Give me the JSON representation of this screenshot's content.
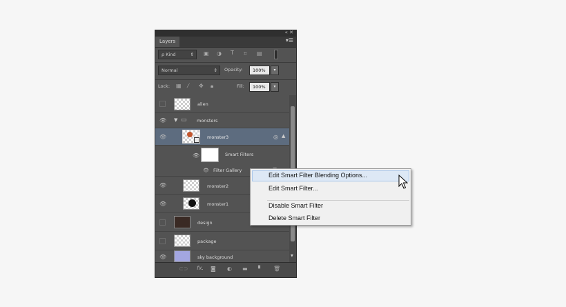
{
  "panel": {
    "tab_label": "Layers",
    "window_controls": "« ✕",
    "menu_icon": "menu-icon"
  },
  "filter_row": {
    "kind_label": "ρ Kind",
    "filter_icons": [
      "pixel-filter-icon",
      "adjustment-filter-icon",
      "type-filter-icon",
      "shape-filter-icon",
      "smart-object-filter-icon"
    ]
  },
  "blend_row": {
    "blend_mode": "Normal",
    "opacity_label": "Opacity:",
    "opacity_value": "100%"
  },
  "lock_row": {
    "lock_label": "Lock:",
    "fill_label": "Fill:",
    "fill_value": "100%"
  },
  "layers": [
    {
      "name": "alien",
      "visible": false
    },
    {
      "name": "monsters",
      "visible": true,
      "type": "group"
    },
    {
      "name": "monster3",
      "visible": true,
      "selected": true
    },
    {
      "name": "Smart Filters",
      "visible": true,
      "type": "smart-filters"
    },
    {
      "name": "Filter Gallery",
      "visible": true,
      "type": "filter"
    },
    {
      "name": "monster2",
      "visible": true
    },
    {
      "name": "monster1",
      "visible": true
    },
    {
      "name": "design",
      "visible": false
    },
    {
      "name": "package",
      "visible": false
    },
    {
      "name": "sky background",
      "visible": true
    }
  ],
  "bottom_icons": [
    "link-icon",
    "fx-icon",
    "mask-icon",
    "adjustment-icon",
    "folder-icon",
    "new-layer-icon",
    "trash-icon"
  ],
  "bottom_fx_label": "fx.",
  "context_menu": {
    "items": [
      "Edit Smart Filter Blending Options...",
      "Edit Smart Filter...",
      "Disable Smart Filter",
      "Delete Smart Filter"
    ]
  },
  "colors": {
    "panel_bg": "#535353",
    "selected_layer": "#5d6c7f",
    "menu_highlight": "#dde8f5"
  }
}
